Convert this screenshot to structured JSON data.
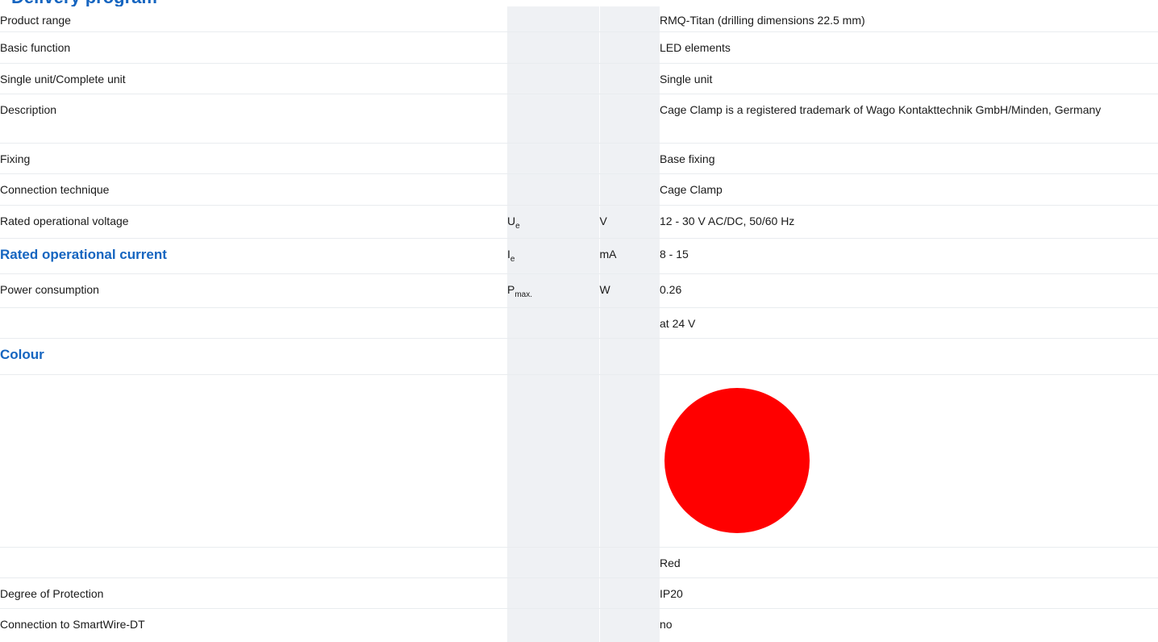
{
  "header": {
    "title": "Delivery program"
  },
  "rows": {
    "product_range": {
      "label": "Product range",
      "value": "RMQ-Titan (drilling dimensions 22.5 mm)"
    },
    "basic_function": {
      "label": "Basic function",
      "value": "LED elements"
    },
    "single_complete": {
      "label": "Single unit/Complete unit",
      "value": "Single unit"
    },
    "description": {
      "label": "Description",
      "value": "Cage Clamp is a registered trademark of Wago Kontakttechnik GmbH/Minden, Germany"
    },
    "fixing": {
      "label": "Fixing",
      "value": "Base fixing"
    },
    "connection_technique": {
      "label": "Connection technique",
      "value": "Cage Clamp"
    },
    "rated_voltage": {
      "label": "Rated operational voltage",
      "symbol": "U",
      "symbol_sub": "e",
      "unit": "V",
      "value": "12 - 30 V AC/DC, 50/60 Hz"
    },
    "rated_current": {
      "label": "Rated operational current",
      "symbol": "I",
      "symbol_sub": "e",
      "unit": "mA",
      "value": "8 - 15"
    },
    "power_consumption": {
      "label": "Power consumption",
      "symbol": "P",
      "symbol_sub": "max.",
      "unit": "W",
      "value": "0.26"
    },
    "power_note": {
      "value": "at 24 V"
    },
    "colour": {
      "label": "Colour",
      "swatch_color": "#ff0000",
      "value": "Red"
    },
    "degree_protection": {
      "label": "Degree of Protection",
      "value": "IP20"
    },
    "smartwire": {
      "label": "Connection to SmartWire-DT",
      "value": "no"
    }
  }
}
